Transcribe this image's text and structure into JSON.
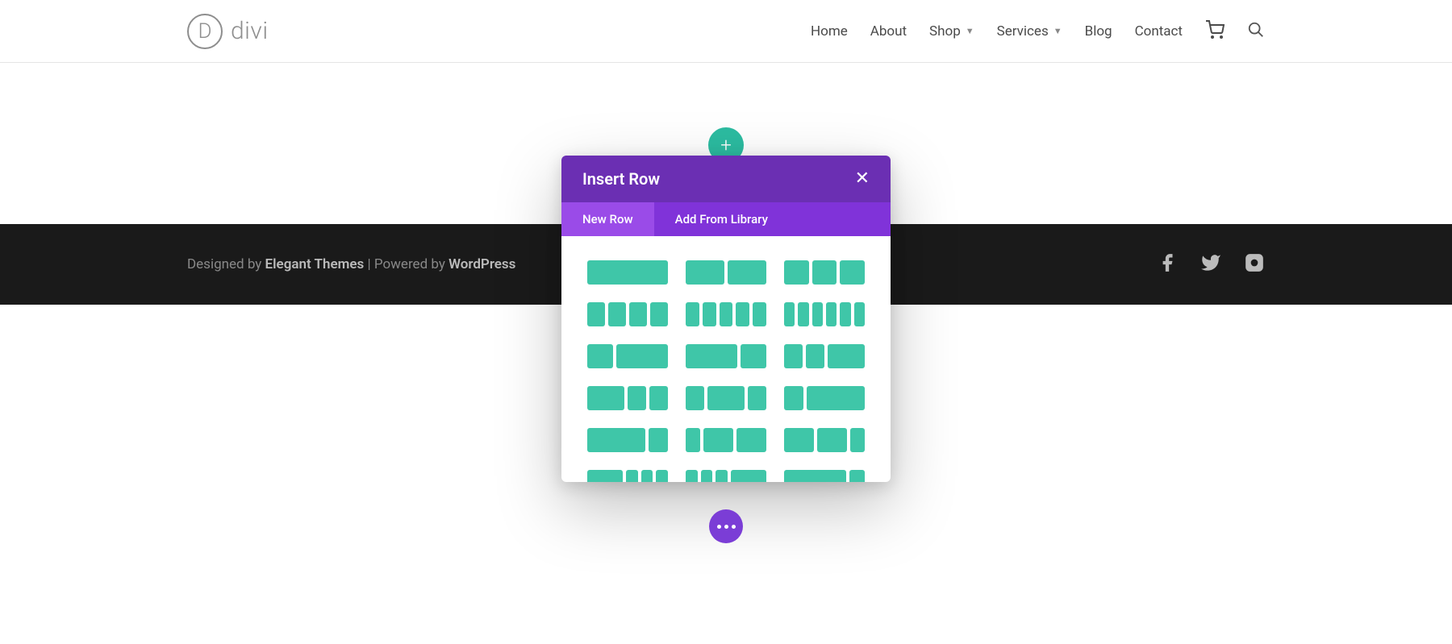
{
  "logo": {
    "letter": "D",
    "text": "divi"
  },
  "nav": {
    "home": "Home",
    "about": "About",
    "shop": "Shop",
    "services": "Services",
    "blog": "Blog",
    "contact": "Contact"
  },
  "footer": {
    "designed_by_prefix": "Designed by ",
    "designed_by_link": "Elegant Themes",
    "powered_by_prefix": " | Powered by ",
    "powered_by_link": "WordPress"
  },
  "modal": {
    "title": "Insert Row",
    "tab_new": "New Row",
    "tab_library": "Add From Library"
  },
  "layouts": [
    [
      1
    ],
    [
      2,
      2
    ],
    [
      1,
      1,
      1
    ],
    [
      1,
      1,
      1,
      1
    ],
    [
      1,
      1,
      1,
      1,
      1
    ],
    [
      1,
      1,
      1,
      1,
      1,
      1
    ],
    [
      1,
      2
    ],
    [
      2,
      1
    ],
    [
      1,
      1,
      2
    ],
    [
      2,
      1,
      1
    ],
    [
      1,
      2,
      1
    ],
    [
      1,
      3
    ],
    [
      3,
      1
    ],
    [
      1,
      2,
      2
    ],
    [
      2,
      2,
      1
    ],
    [
      3,
      1,
      1,
      1
    ],
    [
      1,
      1,
      1,
      3
    ],
    [
      4,
      1
    ]
  ],
  "colors": {
    "teal": "#2cbca1",
    "purple_dark": "#6b2fb3",
    "purple_mid": "#8033d9",
    "purple_light": "#9a4be8",
    "purple_btn": "#7b3dd6",
    "layout_fill": "#3fc6a8"
  }
}
